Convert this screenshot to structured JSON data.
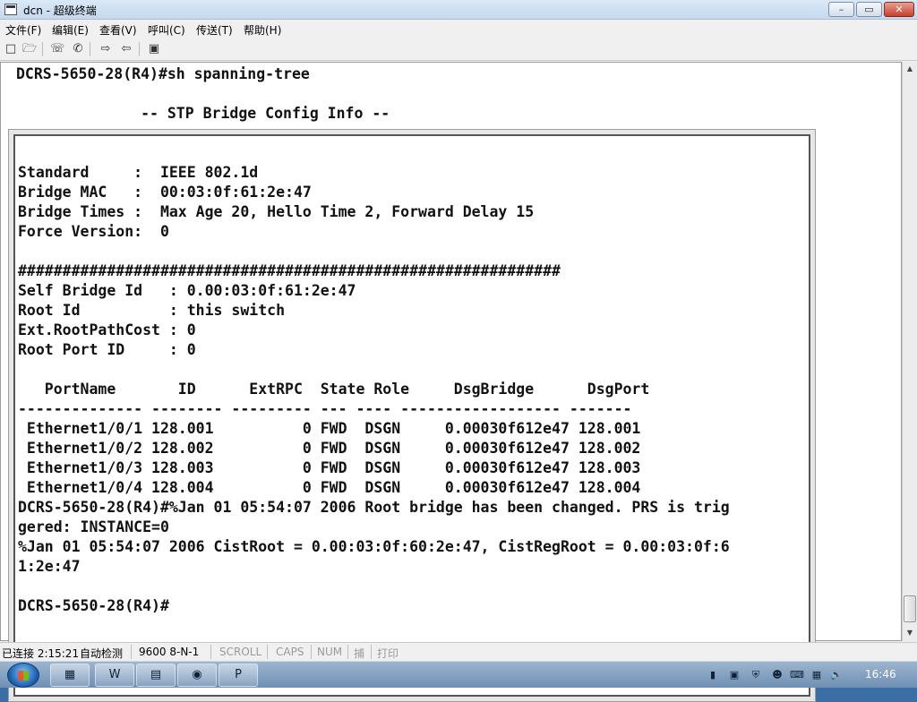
{
  "window": {
    "title": "dcn - 超级终端",
    "minimize_label": "–",
    "maximize_label": "▭",
    "close_label": "✕"
  },
  "menu": [
    {
      "label": "文件(F)"
    },
    {
      "label": "编辑(E)"
    },
    {
      "label": "查看(V)"
    },
    {
      "label": "呼叫(C)"
    },
    {
      "label": "传送(T)"
    },
    {
      "label": "帮助(H)"
    }
  ],
  "toolbar": {
    "icons": [
      "new-icon",
      "open-icon",
      "disconnect-icon",
      "dial-icon",
      "send-icon",
      "receive-icon",
      "properties-icon"
    ]
  },
  "terminal": {
    "lines_top": [
      "DCRS-5650-28(R4)#sh spanning-tree",
      "",
      "              -- STP Bridge Config Info --"
    ],
    "lines": [
      "",
      "Standard     :  IEEE 802.1d",
      "Bridge MAC   :  00:03:0f:61:2e:47",
      "Bridge Times :  Max Age 20, Hello Time 2, Forward Delay 15",
      "Force Version:  0",
      "",
      "#############################################################",
      "Self Bridge Id   : 0.00:03:0f:61:2e:47",
      "Root Id          : this switch",
      "Ext.RootPathCost : 0",
      "Root Port ID     : 0",
      "",
      "   PortName       ID      ExtRPC  State Role     DsgBridge      DsgPort",
      "-------------- -------- --------- --- ---- ------------------ -------",
      " Ethernet1/0/1 128.001          0 FWD  DSGN     0.00030f612e47 128.001",
      " Ethernet1/0/2 128.002          0 FWD  DSGN     0.00030f612e47 128.002",
      " Ethernet1/0/3 128.003          0 FWD  DSGN     0.00030f612e47 128.003",
      " Ethernet1/0/4 128.004          0 FWD  DSGN     0.00030f612e47 128.004",
      "DCRS-5650-28(R4)#%Jan 01 05:54:07 2006 Root bridge has been changed. PRS is trig",
      "gered: INSTANCE=0",
      "%Jan 01 05:54:07 2006 CistRoot = 0.00:03:0f:60:2e:47, CistRegRoot = 0.00:03:0f:6",
      "1:2e:47",
      "",
      "DCRS-5650-28(R4)#"
    ]
  },
  "statusbar": {
    "connection": "已连接 2:15:21",
    "detect": "自动检测",
    "port": "9600 8-N-1",
    "scroll": "SCROLL",
    "caps": "CAPS",
    "num": "NUM",
    "capture": "捕",
    "print": "打印"
  },
  "taskbar": {
    "apps": [
      "explorer-icon",
      "word-icon",
      "folder-icon",
      "archive-icon",
      "powerpoint-icon"
    ],
    "clock": "16:46"
  }
}
